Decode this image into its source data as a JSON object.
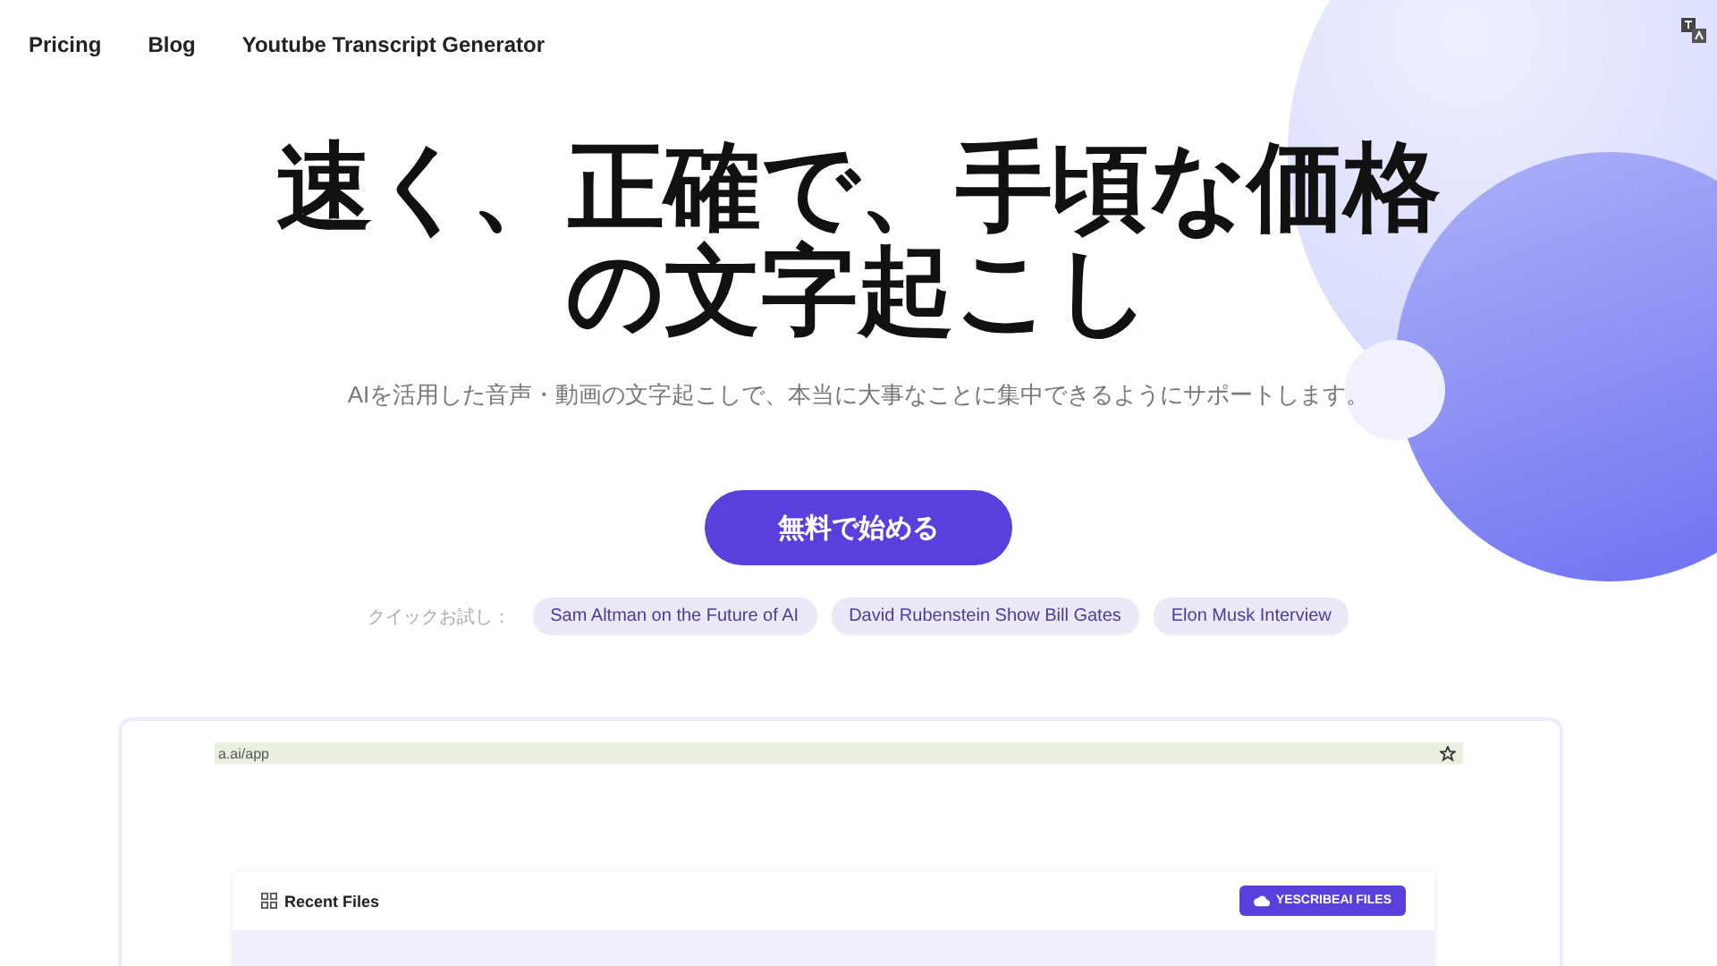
{
  "nav": {
    "links": [
      "Pricing",
      "Blog",
      "Youtube Transcript Generator"
    ]
  },
  "hero": {
    "title_lines": [
      "速く、正確で、手頃な価格",
      "の文字起こし"
    ],
    "subtitle": "AIを活用した音声・動画の文字起こしで、本当に大事なことに集中できるようにサポートします。",
    "cta": "無料で始める"
  },
  "quick_try": {
    "label": "クイックお試し：",
    "chips": [
      "Sam Altman on the Future of AI",
      "David Rubenstein Show Bill Gates",
      "Elon Musk Interview"
    ]
  },
  "preview": {
    "url": "a.ai/app",
    "panel_title": "Recent Files",
    "upload_button": "YESCRIBEAI FILES"
  }
}
